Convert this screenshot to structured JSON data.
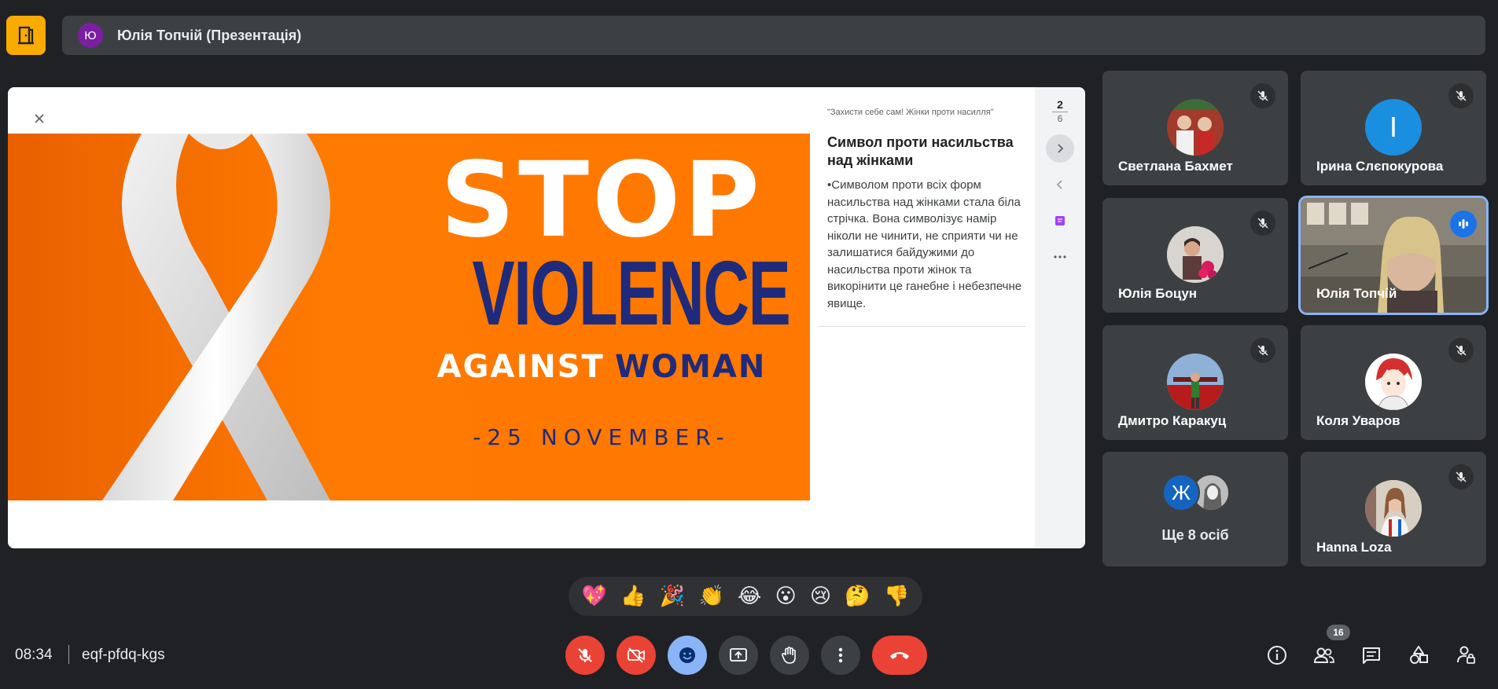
{
  "header": {
    "presenter_initial": "Ю",
    "presenter_name": "Юлія Топчій (Презентація)"
  },
  "presentation": {
    "slide": {
      "line1": "STOP",
      "line2": "VIOLENCE",
      "line3a": "AGAINST",
      "line3b": "WOMAN",
      "line4": "-25 NOVEMBER-"
    },
    "notes": {
      "doc_title": "\"Захисти себе сам! Жінки проти насилля\"",
      "heading": "Символ проти насильства над жінками",
      "body": "•Символом проти всіх форм насильства над жінками стала біла стрічка. Вона символізує намір ніколи не чинити, не сприяти чи не залишатися байдужими до насильства проти жінок та викорінити це ганебне і небезпечне явище."
    },
    "page_current": "2",
    "page_total": "6"
  },
  "participants": [
    {
      "name": "Светлана Бахмет",
      "muted": true
    },
    {
      "name": "Ірина Слєпокурова",
      "initial": "І",
      "muted": true,
      "color": "#1a8fe0"
    },
    {
      "name": "Юлія Боцун",
      "muted": true
    },
    {
      "name": "Юлія Топчій",
      "muted": false,
      "speaking": true
    },
    {
      "name": "Дмитро Каракуц",
      "muted": true
    },
    {
      "name": "Коля Уваров",
      "muted": true
    },
    {
      "name": "Ще 8 осіб",
      "initial": "Ж"
    },
    {
      "name": "Hanna Loza",
      "muted": true
    }
  ],
  "reactions": [
    "💖",
    "👍",
    "🎉",
    "👏",
    "😂",
    "😮",
    "😢",
    "🤔",
    "👎"
  ],
  "bottom": {
    "time": "08:34",
    "meeting_code": "eqf-pfdq-kgs",
    "participant_count": "16"
  },
  "colors": {
    "background": "#202124",
    "tile": "#3c4043",
    "danger": "#ea4335",
    "accent": "#8ab4f8",
    "slide_orange": "#ff7800",
    "slide_navy": "#1f2a7a"
  }
}
